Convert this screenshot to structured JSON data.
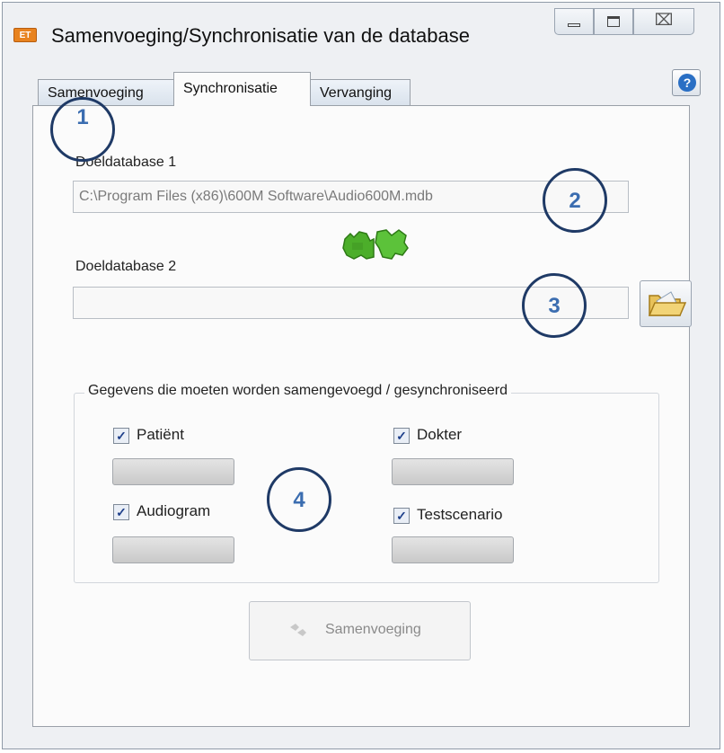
{
  "window": {
    "title": "Samenvoeging/Synchronisatie van de database",
    "app_icon_text": "ET",
    "close_glyph": "⌧"
  },
  "tabs": [
    {
      "label": "Samenvoeging"
    },
    {
      "label": "Synchronisatie",
      "active": true
    },
    {
      "label": "Vervanging"
    }
  ],
  "help": {
    "glyph": "?"
  },
  "db1": {
    "label": "Doeldatabase 1",
    "value": "C:\\Program Files (x86)\\600M Software\\Audio600M.mdb"
  },
  "db2": {
    "label": "Doeldatabase 2",
    "value": ""
  },
  "group": {
    "legend": "Gegevens die moeten worden samengevoegd / gesynchroniseerd",
    "items": [
      {
        "label": "Patiënt",
        "checked": true
      },
      {
        "label": "Dokter",
        "checked": true
      },
      {
        "label": "Audiogram",
        "checked": true
      },
      {
        "label": "Testscenario",
        "checked": true
      }
    ]
  },
  "merge_button": {
    "label": "Samenvoeging"
  },
  "annotations": [
    "1",
    "2",
    "3",
    "4"
  ],
  "colors": {
    "accent": "#3b6db0",
    "circle_border": "#1f3a66",
    "icon_green": "#4cae2a"
  }
}
